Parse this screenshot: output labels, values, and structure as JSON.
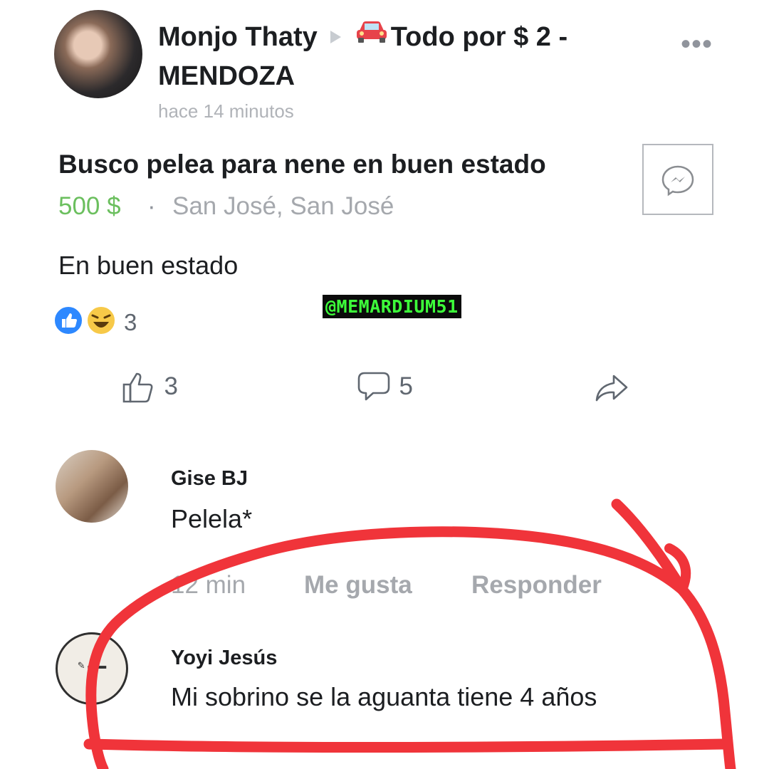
{
  "post": {
    "author": "Monjo  Thaty",
    "group_line1": "Todo por $ 2 -",
    "group_line2": "MENDOZA",
    "timestamp": "hace 14 minutos",
    "more_label": "•••"
  },
  "listing": {
    "title": "Busco pelea para nene en buen estado",
    "price": "500 $",
    "separator": "·",
    "location": "San José, San José",
    "description": "En buen estado",
    "messenger_icon": "messenger-icon"
  },
  "watermark": "@MEMARDIUM51",
  "reactions": {
    "count": "3",
    "types": [
      "like",
      "haha"
    ]
  },
  "actions": {
    "likes": "3",
    "comments": "5",
    "share_icon": "share-icon"
  },
  "comments": [
    {
      "name": "Gise BJ",
      "text": "Pelela*",
      "time": "12 min",
      "like_label": "Me gusta",
      "reply_label": "Responder"
    },
    {
      "name": "Yoyi Jesús",
      "text": "Mi sobrino se la aguanta tiene 4 años"
    }
  ],
  "colors": {
    "price_green": "#6bbf5e",
    "annotation_red": "#f0343a",
    "like_blue": "#2d88ff",
    "muted_text": "#a5a8ad"
  }
}
